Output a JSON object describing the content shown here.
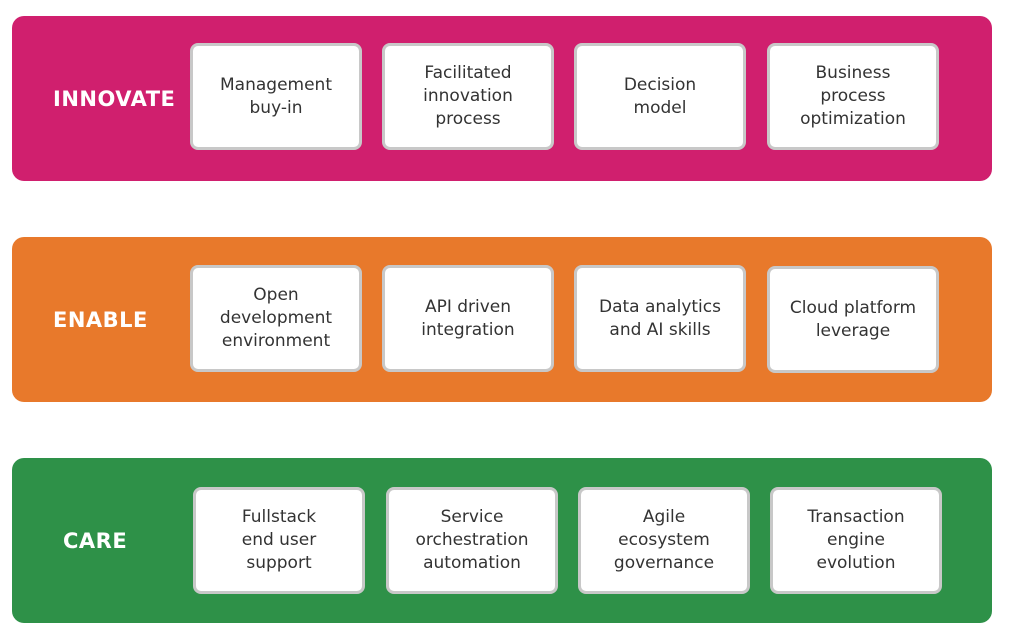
{
  "rows": [
    {
      "label": "INNOVATE",
      "color": "#d01f6e",
      "items": [
        "Management\nbuy-in",
        "Facilitated\ninnovation\nprocess",
        "Decision\nmodel",
        "Business\nprocess\noptimization"
      ]
    },
    {
      "label": "ENABLE",
      "color": "#e8792b",
      "items": [
        "Open\ndevelopment\nenvironment",
        "API driven\nintegration",
        "Data analytics\nand AI skills",
        "Cloud platform\nleverage"
      ]
    },
    {
      "label": "CARE",
      "color": "#2e9148",
      "items": [
        "Fullstack\nend user\nsupport",
        "Service\norchestration\nautomation",
        "Agile\necosystem\ngovernance",
        "Transaction\nengine\nevolution"
      ]
    }
  ]
}
